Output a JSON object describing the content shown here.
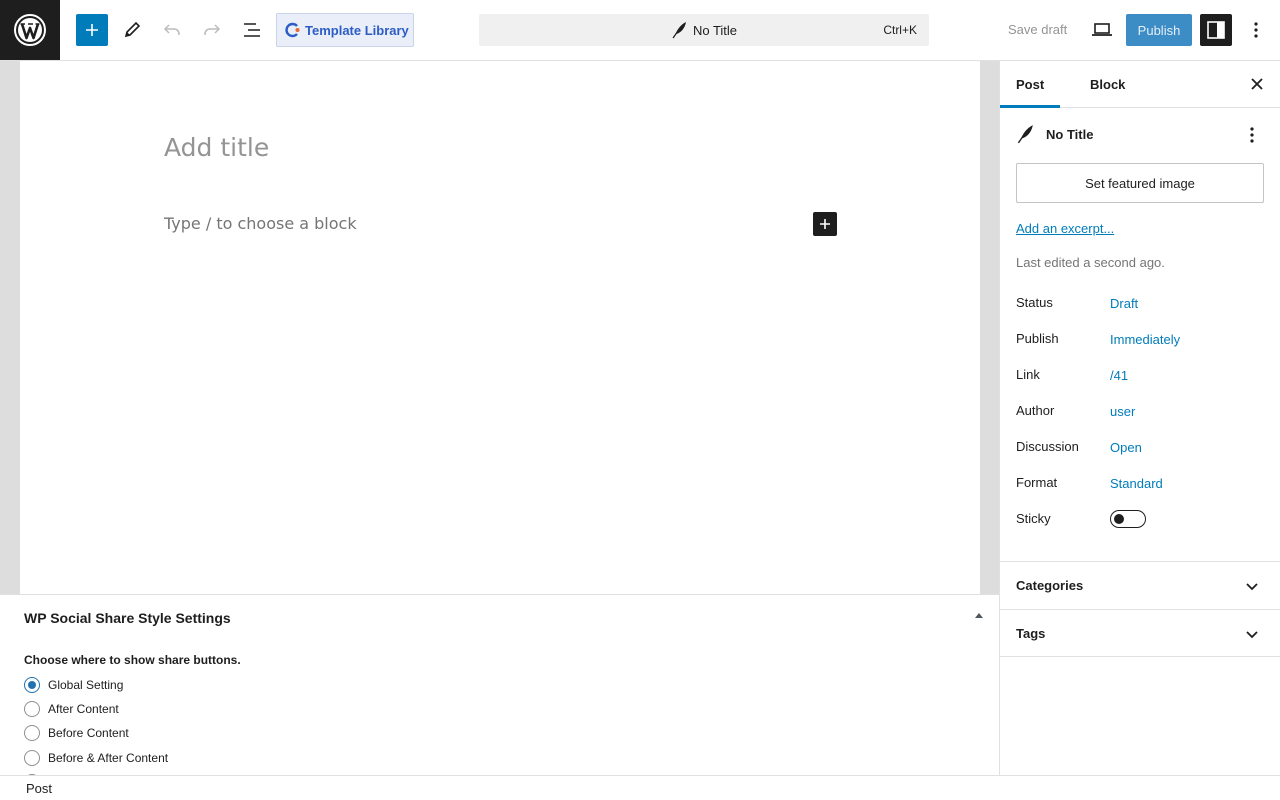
{
  "topbar": {
    "template_library": "Template Library",
    "document_title": "No Title",
    "shortcut": "Ctrl+K",
    "save_draft": "Save draft",
    "publish": "Publish"
  },
  "editor": {
    "title_placeholder": "Add title",
    "block_placeholder": "Type / to choose a block"
  },
  "metabox": {
    "title": "WP Social Share Style Settings",
    "question": "Choose where to show share buttons.",
    "options": [
      {
        "label": "Global Setting",
        "checked": true
      },
      {
        "label": "After Content",
        "checked": false
      },
      {
        "label": "Before Content",
        "checked": false
      },
      {
        "label": "Before & After Content",
        "checked": false
      }
    ]
  },
  "footer": {
    "breadcrumb": "Post"
  },
  "sidebar": {
    "tabs": [
      "Post",
      "Block"
    ],
    "doc_title": "No Title",
    "featured_image": "Set featured image",
    "excerpt_link": "Add an excerpt...",
    "last_edited": "Last edited a second ago.",
    "meta": [
      {
        "label": "Status",
        "value": "Draft"
      },
      {
        "label": "Publish",
        "value": "Immediately"
      },
      {
        "label": "Link",
        "value": "/41"
      },
      {
        "label": "Author",
        "value": "user"
      },
      {
        "label": "Discussion",
        "value": "Open"
      },
      {
        "label": "Format",
        "value": "Standard"
      }
    ],
    "sticky_label": "Sticky",
    "sticky_on": false,
    "panels": [
      "Categories",
      "Tags"
    ]
  },
  "colors": {
    "accent": "#007cba",
    "dark": "#1e1e1e"
  }
}
